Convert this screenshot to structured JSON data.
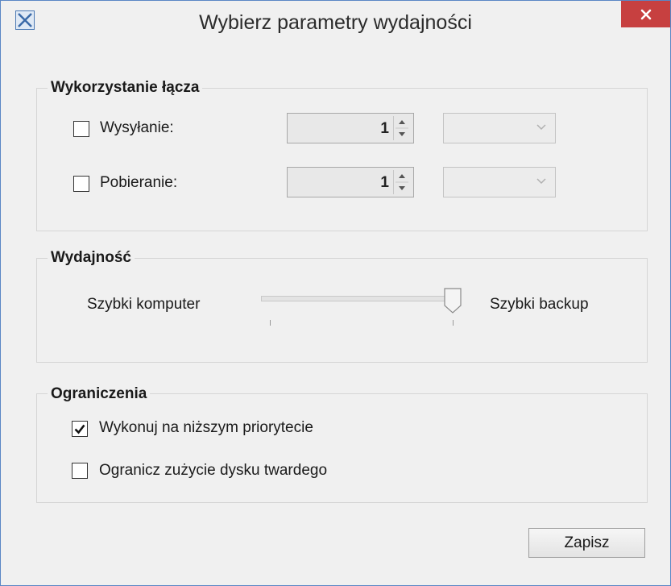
{
  "window": {
    "title": "Wybierz parametry wydajności",
    "close_glyph": "×",
    "accent_color": "#c74040"
  },
  "bandwidth": {
    "group_title": "Wykorzystanie łącza",
    "upload": {
      "label": "Wysyłanie:",
      "checked": false,
      "value": "1",
      "unit": ""
    },
    "download": {
      "label": "Pobieranie:",
      "checked": false,
      "value": "1",
      "unit": ""
    }
  },
  "performance": {
    "group_title": "Wydajność",
    "left_label": "Szybki komputer",
    "right_label": "Szybki backup",
    "slider_level": 1.0
  },
  "limits": {
    "group_title": "Ograniczenia",
    "low_priority": {
      "label": "Wykonuj na niższym priorytecie",
      "checked": true
    },
    "limit_disk": {
      "label": "Ogranicz zużycie dysku twardego",
      "checked": false
    }
  },
  "actions": {
    "save_label": "Zapisz"
  },
  "icons": {
    "app": "app-icon",
    "close": "close-icon",
    "check": "checkmark-icon",
    "spin": "spinner-arrows-icon",
    "dropdown": "chevron-down-icon"
  }
}
